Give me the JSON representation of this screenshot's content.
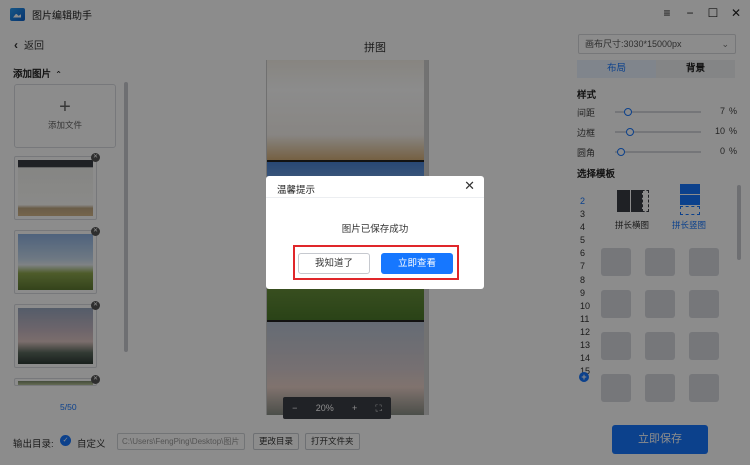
{
  "app": {
    "title": "图片编辑助手"
  },
  "window_controls": {
    "menu": "≡",
    "minimize": "−",
    "maximize": "☐",
    "close": "✕"
  },
  "topbar": {
    "back_label": "返回",
    "center_title": "拼图",
    "canvas_size": "画布尺寸:3030*15000px"
  },
  "left": {
    "add_title": "添加图片",
    "add_file_label": "添加文件",
    "counter": "5/50",
    "thumbnails": [
      "whiteboard-photo",
      "sky-and-field",
      "sunset-field",
      "landscape"
    ]
  },
  "zoom": {
    "minus": "−",
    "value": "20%",
    "plus": "+"
  },
  "right": {
    "tabs": [
      "布局",
      "背景"
    ],
    "style_title": "样式",
    "sliders": [
      {
        "label": "间距",
        "value": "7",
        "unit": "%",
        "level": 0.07
      },
      {
        "label": "边框",
        "value": "10",
        "unit": "%",
        "level": 0.1
      },
      {
        "label": "圆角",
        "value": "0",
        "unit": "%",
        "level": 0.0
      }
    ],
    "template_title": "选择模板",
    "numbers": [
      "2",
      "3",
      "4",
      "5",
      "6",
      "7",
      "8",
      "9",
      "10",
      "11",
      "12",
      "13",
      "14",
      "15"
    ],
    "templates": {
      "horizontal": "拼长横图",
      "vertical": "拼长竖图"
    }
  },
  "bottom": {
    "output_label": "输出目录:",
    "custom_label": "自定义",
    "path": "C:\\Users\\FengPing\\Desktop\\图片",
    "change_dir": "更改目录",
    "open_folder": "打开文件夹",
    "save": "立即保存"
  },
  "dialog": {
    "title": "温馨提示",
    "close": "✕",
    "message": "图片已保存成功",
    "btn_know": "我知道了",
    "btn_view": "立即查看"
  },
  "colors": {
    "accent": "#1677ff",
    "highlight_frame": "#e0262a",
    "overlay": "rgba(0,0,0,0.45)"
  }
}
